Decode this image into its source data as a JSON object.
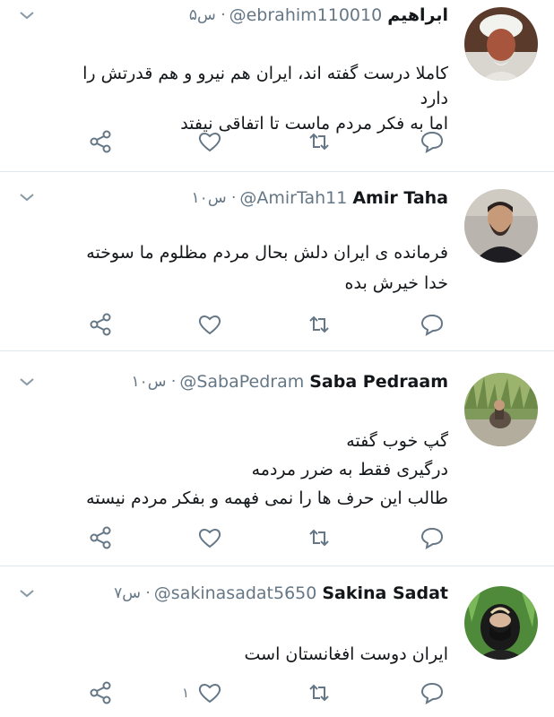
{
  "icons": {
    "caret": "chevron-down-icon",
    "share": "share-icon",
    "like": "heart-icon",
    "retweet": "retweet-icon",
    "reply": "reply-icon"
  },
  "colors": {
    "text": "#14171a",
    "muted": "#657786",
    "icon": "#657786",
    "divider": "#e1e8ed"
  },
  "replies": [
    {
      "name": "ابراهیم",
      "handle": "@ebrahim110010",
      "meta": "۵س ·",
      "lines": [
        "کاملا درست گفته اند، ایران هم نیرو و هم قدرتش را دارد",
        "اما به فکر مردم ماست تا اتفاقی نیفتد"
      ],
      "like_count": ""
    },
    {
      "name": "Amir Taha",
      "handle": "@AmirTah11",
      "meta": "۱۰س ·",
      "lines": [
        "فرمانده ی ایران دلش بحال مردم مظلوم ما سوخته",
        "خدا خیرش بده"
      ],
      "like_count": ""
    },
    {
      "name": "Saba Pedraam",
      "handle": "@SabaPedram",
      "meta": "۱۰س ·",
      "lines": [
        "گپ خوب گفته",
        "درگیری فقط به ضرر مردمه",
        "طالب این حرف ها را نمی فهمه و بفکر مردم نیسته"
      ],
      "like_count": ""
    },
    {
      "name": "Sakina Sadat",
      "handle": "@sakinasadat5650",
      "meta": "۷س ·",
      "lines": [
        "ایران دوست افغانستان است"
      ],
      "like_count": "۱"
    }
  ]
}
